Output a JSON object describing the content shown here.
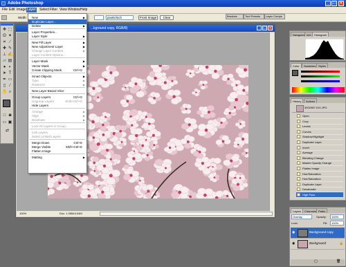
{
  "app": {
    "title": "Adobe Photoshop"
  },
  "window_buttons": [
    "_",
    "□",
    "×"
  ],
  "menubar": [
    "File",
    "Edit",
    "Image",
    "Layer",
    "Select",
    "Filter",
    "View",
    "Window",
    "Help"
  ],
  "options": {
    "width_label": "Width:",
    "resolution_unit": "pixels/inch",
    "front_image": "Front Image",
    "clear": "Clear"
  },
  "palette_well": [
    "Brushes",
    "Tool Presets",
    "Layer Comps"
  ],
  "document": {
    "title": "...kground copy, RGB/8)",
    "zoom": "100%",
    "status": "Doc: 1.05M/4.04M"
  },
  "layer_menu": [
    {
      "label": "New",
      "arrow": true
    },
    {
      "label": "Duplicate Layer...",
      "highlight": true
    },
    {
      "label": "Delete",
      "arrow": true
    },
    {
      "sep": true
    },
    {
      "label": "Layer Properties..."
    },
    {
      "label": "Layer Style",
      "arrow": true
    },
    {
      "sep": true
    },
    {
      "label": "New Fill Layer",
      "arrow": true
    },
    {
      "label": "New Adjustment Layer",
      "arrow": true
    },
    {
      "label": "Change Layer Content",
      "arrow": true,
      "disabled": true
    },
    {
      "label": "Layer Content Options...",
      "disabled": true
    },
    {
      "sep": true
    },
    {
      "label": "Layer Mask",
      "arrow": true
    },
    {
      "label": "Vector Mask",
      "arrow": true
    },
    {
      "label": "Create Clipping Mask",
      "shortcut": "Ctrl+G"
    },
    {
      "sep": true
    },
    {
      "label": "Smart Objects",
      "arrow": true
    },
    {
      "label": "Type",
      "arrow": true,
      "disabled": true
    },
    {
      "label": "Rasterize",
      "arrow": true,
      "disabled": true
    },
    {
      "sep": true
    },
    {
      "label": "New Layer Based Slice"
    },
    {
      "sep": true
    },
    {
      "label": "Group Layers",
      "shortcut": "Ctrl+G"
    },
    {
      "label": "Ungroup Layers",
      "shortcut": "Shift+Ctrl+G",
      "disabled": true
    },
    {
      "label": "Hide Layers"
    },
    {
      "sep": true
    },
    {
      "label": "Arrange",
      "arrow": true,
      "disabled": true
    },
    {
      "label": "Align",
      "arrow": true,
      "disabled": true
    },
    {
      "label": "Distribute",
      "arrow": true,
      "disabled": true
    },
    {
      "sep": true
    },
    {
      "label": "Lock All Layers in Group...",
      "disabled": true
    },
    {
      "sep": true
    },
    {
      "label": "Link Layers",
      "disabled": true
    },
    {
      "label": "Select Linked Layers",
      "disabled": true
    },
    {
      "sep": true
    },
    {
      "label": "Merge Down",
      "shortcut": "Ctrl+E"
    },
    {
      "label": "Merge Visible",
      "shortcut": "Shift+Ctrl+E"
    },
    {
      "label": "Flatten Image"
    },
    {
      "sep": true
    },
    {
      "label": "Matting",
      "arrow": true
    }
  ],
  "navigator": {
    "tabs": [
      "Navigator",
      "Info",
      "Histogram"
    ],
    "active": 2
  },
  "color": {
    "tabs": [
      "Color",
      "Swatches",
      "Styles"
    ],
    "active": 0
  },
  "history": {
    "tabs": [
      "History",
      "Actions"
    ],
    "snapshot": "3002087-010.JPG",
    "items": [
      "Open",
      "Crop",
      "Levels",
      "Curves",
      "Shadow/Highlight",
      "Duplicate Layer",
      "Invert",
      "Average",
      "Blending Change",
      "Master Opacity Change",
      "Flatten Image",
      "Hue/Saturation",
      "Hue/Saturation",
      "Duplicate Layer",
      "Desaturate",
      "High Pass"
    ]
  },
  "layers": {
    "tabs": [
      "Layers",
      "Channels",
      "Paths"
    ],
    "blend_mode": "Overlay",
    "opacity_label": "Opacity:",
    "opacity_value": "100%",
    "fill_label": "Fill:",
    "fill_value": "100%",
    "lock_label": "Lock:",
    "items": [
      "Background copy",
      "Background"
    ]
  },
  "colors": {
    "menu_highlight": "#316ac5",
    "title_bar": "#1d5cd8",
    "app_bg": "#6b6b6b"
  }
}
